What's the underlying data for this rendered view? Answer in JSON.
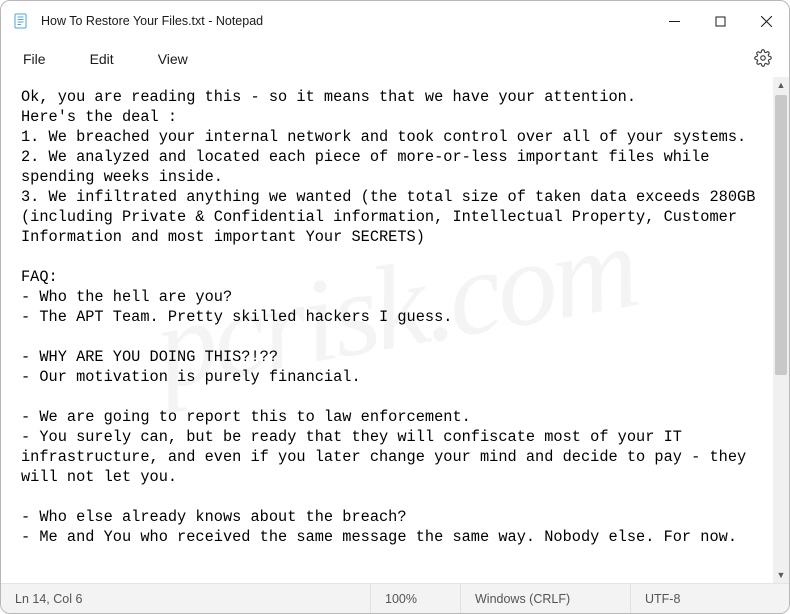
{
  "titlebar": {
    "title": "How To Restore Your Files.txt - Notepad"
  },
  "menubar": {
    "file": "File",
    "edit": "Edit",
    "view": "View"
  },
  "document": {
    "text": "Ok, you are reading this - so it means that we have your attention.\nHere's the deal :\n1. We breached your internal network and took control over all of your systems.\n2. We analyzed and located each piece of more-or-less important files while spending weeks inside.\n3. We infiltrated anything we wanted (the total size of taken data exceeds 280GB (including Private & Confidential information, Intellectual Property, Customer Information and most important Your SECRETS)\n\nFAQ:\n- Who the hell are you?\n- The APT Team. Pretty skilled hackers I guess.\n\n- WHY ARE YOU DOING THIS?!??\n- Our motivation is purely financial.\n\n- We are going to report this to law enforcement.\n- You surely can, but be ready that they will confiscate most of your IT infrastructure, and even if you later change your mind and decide to pay - they will not let you.\n\n- Who else already knows about the breach?\n- Me and You who received the same message the same way. Nobody else. For now."
  },
  "statusbar": {
    "position": "Ln 14, Col 6",
    "zoom": "100%",
    "line_ending": "Windows (CRLF)",
    "encoding": "UTF-8"
  },
  "watermark": "pcrisk.com"
}
